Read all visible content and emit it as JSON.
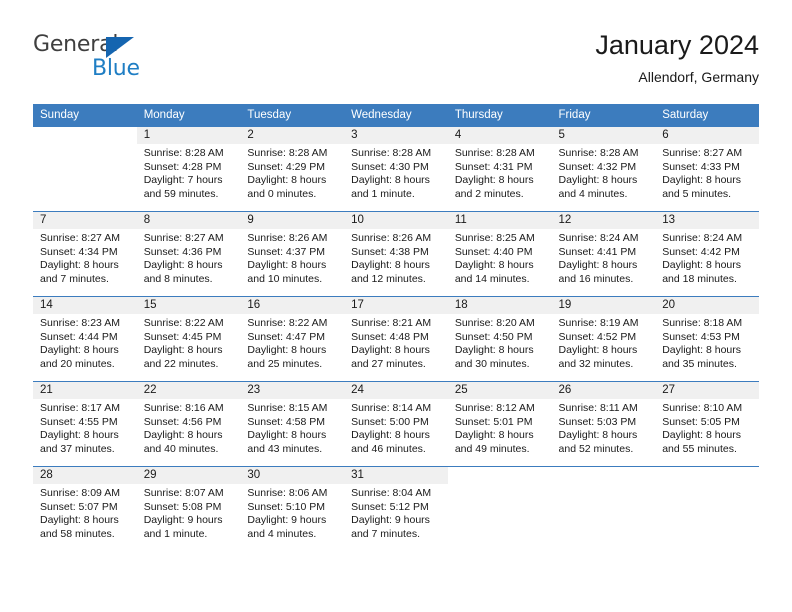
{
  "brand": {
    "name_part1": "General",
    "name_part2": "Blue",
    "accent_color": "#1f7ec4",
    "triangle_color": "#1565b0"
  },
  "header": {
    "title": "January 2024",
    "location": "Allendorf, Germany"
  },
  "calendar": {
    "header_bg": "#3c7cbe",
    "daynum_bg": "#f0f0f0",
    "weekdays": [
      "Sunday",
      "Monday",
      "Tuesday",
      "Wednesday",
      "Thursday",
      "Friday",
      "Saturday"
    ],
    "weeks": [
      [
        {
          "day": "",
          "sunrise": "",
          "sunset": "",
          "daylight": "",
          "daylight2": "",
          "blank": true
        },
        {
          "day": "1",
          "sunrise": "Sunrise: 8:28 AM",
          "sunset": "Sunset: 4:28 PM",
          "daylight": "Daylight: 7 hours",
          "daylight2": "and 59 minutes."
        },
        {
          "day": "2",
          "sunrise": "Sunrise: 8:28 AM",
          "sunset": "Sunset: 4:29 PM",
          "daylight": "Daylight: 8 hours",
          "daylight2": "and 0 minutes."
        },
        {
          "day": "3",
          "sunrise": "Sunrise: 8:28 AM",
          "sunset": "Sunset: 4:30 PM",
          "daylight": "Daylight: 8 hours",
          "daylight2": "and 1 minute."
        },
        {
          "day": "4",
          "sunrise": "Sunrise: 8:28 AM",
          "sunset": "Sunset: 4:31 PM",
          "daylight": "Daylight: 8 hours",
          "daylight2": "and 2 minutes."
        },
        {
          "day": "5",
          "sunrise": "Sunrise: 8:28 AM",
          "sunset": "Sunset: 4:32 PM",
          "daylight": "Daylight: 8 hours",
          "daylight2": "and 4 minutes."
        },
        {
          "day": "6",
          "sunrise": "Sunrise: 8:27 AM",
          "sunset": "Sunset: 4:33 PM",
          "daylight": "Daylight: 8 hours",
          "daylight2": "and 5 minutes."
        }
      ],
      [
        {
          "day": "7",
          "sunrise": "Sunrise: 8:27 AM",
          "sunset": "Sunset: 4:34 PM",
          "daylight": "Daylight: 8 hours",
          "daylight2": "and 7 minutes."
        },
        {
          "day": "8",
          "sunrise": "Sunrise: 8:27 AM",
          "sunset": "Sunset: 4:36 PM",
          "daylight": "Daylight: 8 hours",
          "daylight2": "and 8 minutes."
        },
        {
          "day": "9",
          "sunrise": "Sunrise: 8:26 AM",
          "sunset": "Sunset: 4:37 PM",
          "daylight": "Daylight: 8 hours",
          "daylight2": "and 10 minutes."
        },
        {
          "day": "10",
          "sunrise": "Sunrise: 8:26 AM",
          "sunset": "Sunset: 4:38 PM",
          "daylight": "Daylight: 8 hours",
          "daylight2": "and 12 minutes."
        },
        {
          "day": "11",
          "sunrise": "Sunrise: 8:25 AM",
          "sunset": "Sunset: 4:40 PM",
          "daylight": "Daylight: 8 hours",
          "daylight2": "and 14 minutes."
        },
        {
          "day": "12",
          "sunrise": "Sunrise: 8:24 AM",
          "sunset": "Sunset: 4:41 PM",
          "daylight": "Daylight: 8 hours",
          "daylight2": "and 16 minutes."
        },
        {
          "day": "13",
          "sunrise": "Sunrise: 8:24 AM",
          "sunset": "Sunset: 4:42 PM",
          "daylight": "Daylight: 8 hours",
          "daylight2": "and 18 minutes."
        }
      ],
      [
        {
          "day": "14",
          "sunrise": "Sunrise: 8:23 AM",
          "sunset": "Sunset: 4:44 PM",
          "daylight": "Daylight: 8 hours",
          "daylight2": "and 20 minutes."
        },
        {
          "day": "15",
          "sunrise": "Sunrise: 8:22 AM",
          "sunset": "Sunset: 4:45 PM",
          "daylight": "Daylight: 8 hours",
          "daylight2": "and 22 minutes."
        },
        {
          "day": "16",
          "sunrise": "Sunrise: 8:22 AM",
          "sunset": "Sunset: 4:47 PM",
          "daylight": "Daylight: 8 hours",
          "daylight2": "and 25 minutes."
        },
        {
          "day": "17",
          "sunrise": "Sunrise: 8:21 AM",
          "sunset": "Sunset: 4:48 PM",
          "daylight": "Daylight: 8 hours",
          "daylight2": "and 27 minutes."
        },
        {
          "day": "18",
          "sunrise": "Sunrise: 8:20 AM",
          "sunset": "Sunset: 4:50 PM",
          "daylight": "Daylight: 8 hours",
          "daylight2": "and 30 minutes."
        },
        {
          "day": "19",
          "sunrise": "Sunrise: 8:19 AM",
          "sunset": "Sunset: 4:52 PM",
          "daylight": "Daylight: 8 hours",
          "daylight2": "and 32 minutes."
        },
        {
          "day": "20",
          "sunrise": "Sunrise: 8:18 AM",
          "sunset": "Sunset: 4:53 PM",
          "daylight": "Daylight: 8 hours",
          "daylight2": "and 35 minutes."
        }
      ],
      [
        {
          "day": "21",
          "sunrise": "Sunrise: 8:17 AM",
          "sunset": "Sunset: 4:55 PM",
          "daylight": "Daylight: 8 hours",
          "daylight2": "and 37 minutes."
        },
        {
          "day": "22",
          "sunrise": "Sunrise: 8:16 AM",
          "sunset": "Sunset: 4:56 PM",
          "daylight": "Daylight: 8 hours",
          "daylight2": "and 40 minutes."
        },
        {
          "day": "23",
          "sunrise": "Sunrise: 8:15 AM",
          "sunset": "Sunset: 4:58 PM",
          "daylight": "Daylight: 8 hours",
          "daylight2": "and 43 minutes."
        },
        {
          "day": "24",
          "sunrise": "Sunrise: 8:14 AM",
          "sunset": "Sunset: 5:00 PM",
          "daylight": "Daylight: 8 hours",
          "daylight2": "and 46 minutes."
        },
        {
          "day": "25",
          "sunrise": "Sunrise: 8:12 AM",
          "sunset": "Sunset: 5:01 PM",
          "daylight": "Daylight: 8 hours",
          "daylight2": "and 49 minutes."
        },
        {
          "day": "26",
          "sunrise": "Sunrise: 8:11 AM",
          "sunset": "Sunset: 5:03 PM",
          "daylight": "Daylight: 8 hours",
          "daylight2": "and 52 minutes."
        },
        {
          "day": "27",
          "sunrise": "Sunrise: 8:10 AM",
          "sunset": "Sunset: 5:05 PM",
          "daylight": "Daylight: 8 hours",
          "daylight2": "and 55 minutes."
        }
      ],
      [
        {
          "day": "28",
          "sunrise": "Sunrise: 8:09 AM",
          "sunset": "Sunset: 5:07 PM",
          "daylight": "Daylight: 8 hours",
          "daylight2": "and 58 minutes."
        },
        {
          "day": "29",
          "sunrise": "Sunrise: 8:07 AM",
          "sunset": "Sunset: 5:08 PM",
          "daylight": "Daylight: 9 hours",
          "daylight2": "and 1 minute."
        },
        {
          "day": "30",
          "sunrise": "Sunrise: 8:06 AM",
          "sunset": "Sunset: 5:10 PM",
          "daylight": "Daylight: 9 hours",
          "daylight2": "and 4 minutes."
        },
        {
          "day": "31",
          "sunrise": "Sunrise: 8:04 AM",
          "sunset": "Sunset: 5:12 PM",
          "daylight": "Daylight: 9 hours",
          "daylight2": "and 7 minutes."
        },
        {
          "day": "",
          "sunrise": "",
          "sunset": "",
          "daylight": "",
          "daylight2": "",
          "blank": true
        },
        {
          "day": "",
          "sunrise": "",
          "sunset": "",
          "daylight": "",
          "daylight2": "",
          "blank": true
        },
        {
          "day": "",
          "sunrise": "",
          "sunset": "",
          "daylight": "",
          "daylight2": "",
          "blank": true
        }
      ]
    ]
  }
}
